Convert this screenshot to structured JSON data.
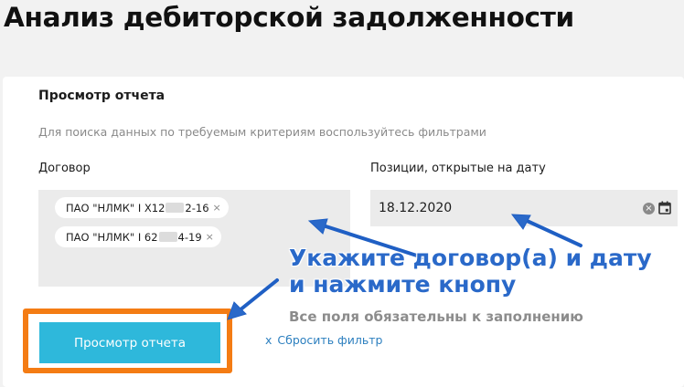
{
  "page": {
    "title": "Анализ дебиторской задолженности"
  },
  "report": {
    "title": "Просмотр отчета",
    "hint": "Для поиска данных по требуемым критериям воспользуйтесь фильтрами"
  },
  "filters": {
    "contract_label": "Договор",
    "contracts": [
      {
        "prefix": "ПАО \"НЛМК\" I Х12",
        "suffix": "2-16",
        "remove": "×"
      },
      {
        "prefix": "ПАО \"НЛМК\" I 62",
        "suffix": "4-19",
        "remove": "×"
      }
    ],
    "date_label": "Позиции, открытые на дату",
    "date_value": "18.12.2020"
  },
  "actions": {
    "view_button": "Просмотр отчета",
    "reset_icon": "x",
    "reset_label": "Сбросить фильтр"
  },
  "annotation": {
    "line1": "Укажите договор(а) и дату",
    "line2": "и нажмите кнопу",
    "note": "Все поля обязательны к заполнению",
    "arrow_color": "#2a69c9",
    "highlight_color": "#f47c14"
  }
}
